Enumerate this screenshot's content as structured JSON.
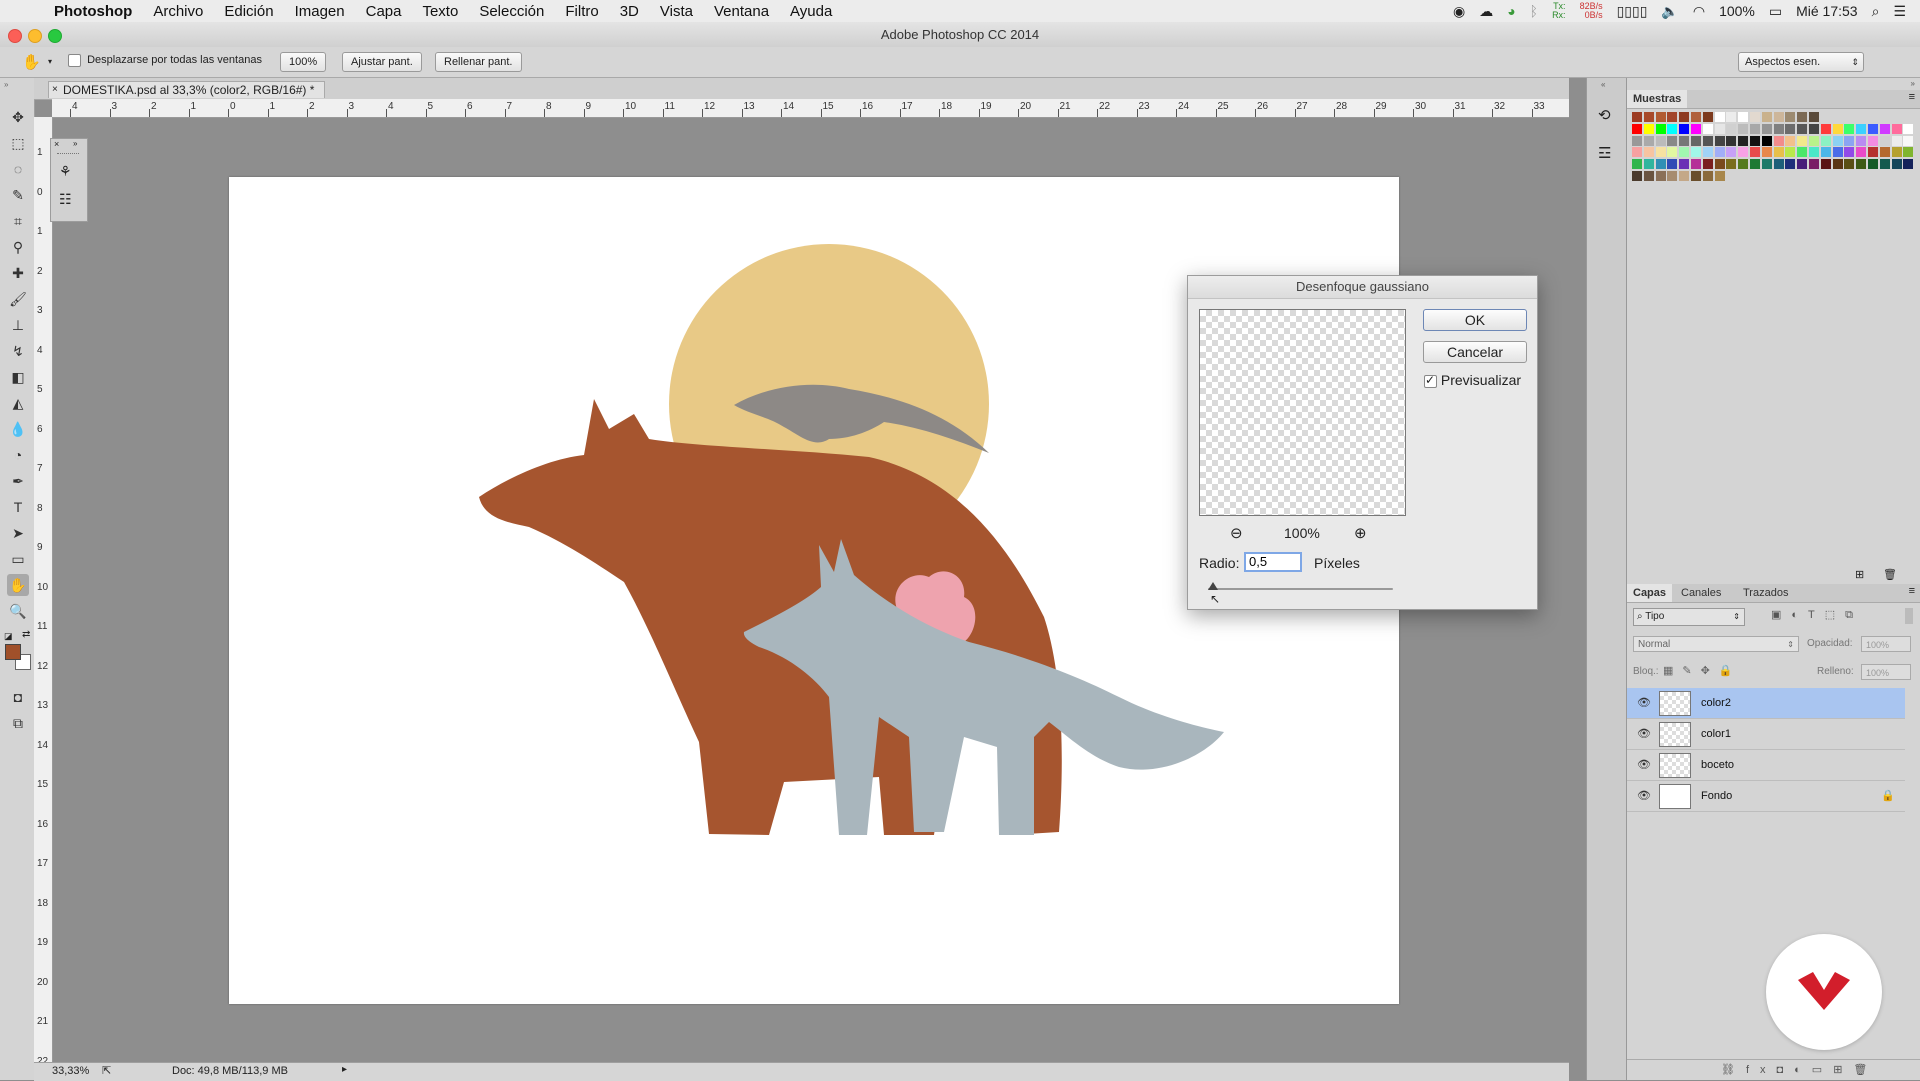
{
  "menubar": {
    "app": "Photoshop",
    "items": [
      "Archivo",
      "Edición",
      "Imagen",
      "Capa",
      "Texto",
      "Selección",
      "Filtro",
      "3D",
      "Vista",
      "Ventana",
      "Ayuda"
    ],
    "net_tx": "82B/s",
    "net_rx": "0B/s",
    "net_tx_label": "Tx:",
    "net_rx_label": "Rx:",
    "battery": "100%",
    "clock": "Mié 17:53"
  },
  "window": {
    "title": "Adobe Photoshop CC 2014"
  },
  "options_bar": {
    "scroll_all_label": "Desplazarse por todas las ventanas",
    "zoom_button": "100%",
    "fit_button": "Ajustar pant.",
    "fill_button": "Rellenar pant.",
    "workspace": "Aspectos esen."
  },
  "document": {
    "tab_label": "DOMESTIKA.psd al 33,3% (color2, RGB/16#) *",
    "ruler_top": [
      "4",
      "3",
      "2",
      "1",
      "0",
      "1",
      "2",
      "3",
      "4",
      "5",
      "6",
      "7",
      "8",
      "9",
      "10",
      "11",
      "12",
      "13",
      "14",
      "15",
      "16",
      "17",
      "18",
      "19",
      "20",
      "21",
      "22",
      "23",
      "24",
      "25",
      "26",
      "27",
      "28",
      "29",
      "30",
      "31",
      "32",
      "33"
    ],
    "ruler_left": [
      "1",
      "0",
      "1",
      "2",
      "3",
      "4",
      "5",
      "6",
      "7",
      "8",
      "9",
      "10",
      "11",
      "12",
      "13",
      "14",
      "15",
      "16",
      "17",
      "18",
      "19",
      "20",
      "21",
      "22"
    ]
  },
  "status": {
    "zoom": "33,33%",
    "doc": "Doc: 49,8 MB/113,9 MB"
  },
  "dialog": {
    "title": "Desenfoque gaussiano",
    "ok": "OK",
    "cancel": "Cancelar",
    "preview_label": "Previsualizar",
    "preview_checked": true,
    "zoom": "100%",
    "radius_label": "Radio:",
    "radius_value": "0,5",
    "unit": "Píxeles",
    "slider_fraction": 0.01
  },
  "swatches_panel": {
    "title": "Muestras"
  },
  "layers_panel": {
    "tabs": [
      "Capas",
      "Canales",
      "Trazados"
    ],
    "filter_placeholder": "Tipo",
    "blend_mode": "Normal",
    "opacity_label": "Opacidad:",
    "opacity_value": "100%",
    "lock_label": "Bloq.:",
    "fill_label": "Relleno:",
    "fill_value": "100%",
    "layers": [
      {
        "name": "color2",
        "selected": true,
        "locked": false,
        "thumb": "checker"
      },
      {
        "name": "color1",
        "selected": false,
        "locked": false,
        "thumb": "checker"
      },
      {
        "name": "boceto",
        "selected": false,
        "locked": false,
        "thumb": "checker"
      },
      {
        "name": "Fondo",
        "selected": false,
        "locked": true,
        "thumb": "white"
      }
    ]
  },
  "colors": {
    "foreground": "#a0502a",
    "background": "#ffffff",
    "moon": "#e8c986",
    "bear": "#a6552f",
    "fox": "#a9b6bd",
    "bird": "#8d8986",
    "tree": "#eea3ae",
    "logo": "#d21e2b"
  }
}
